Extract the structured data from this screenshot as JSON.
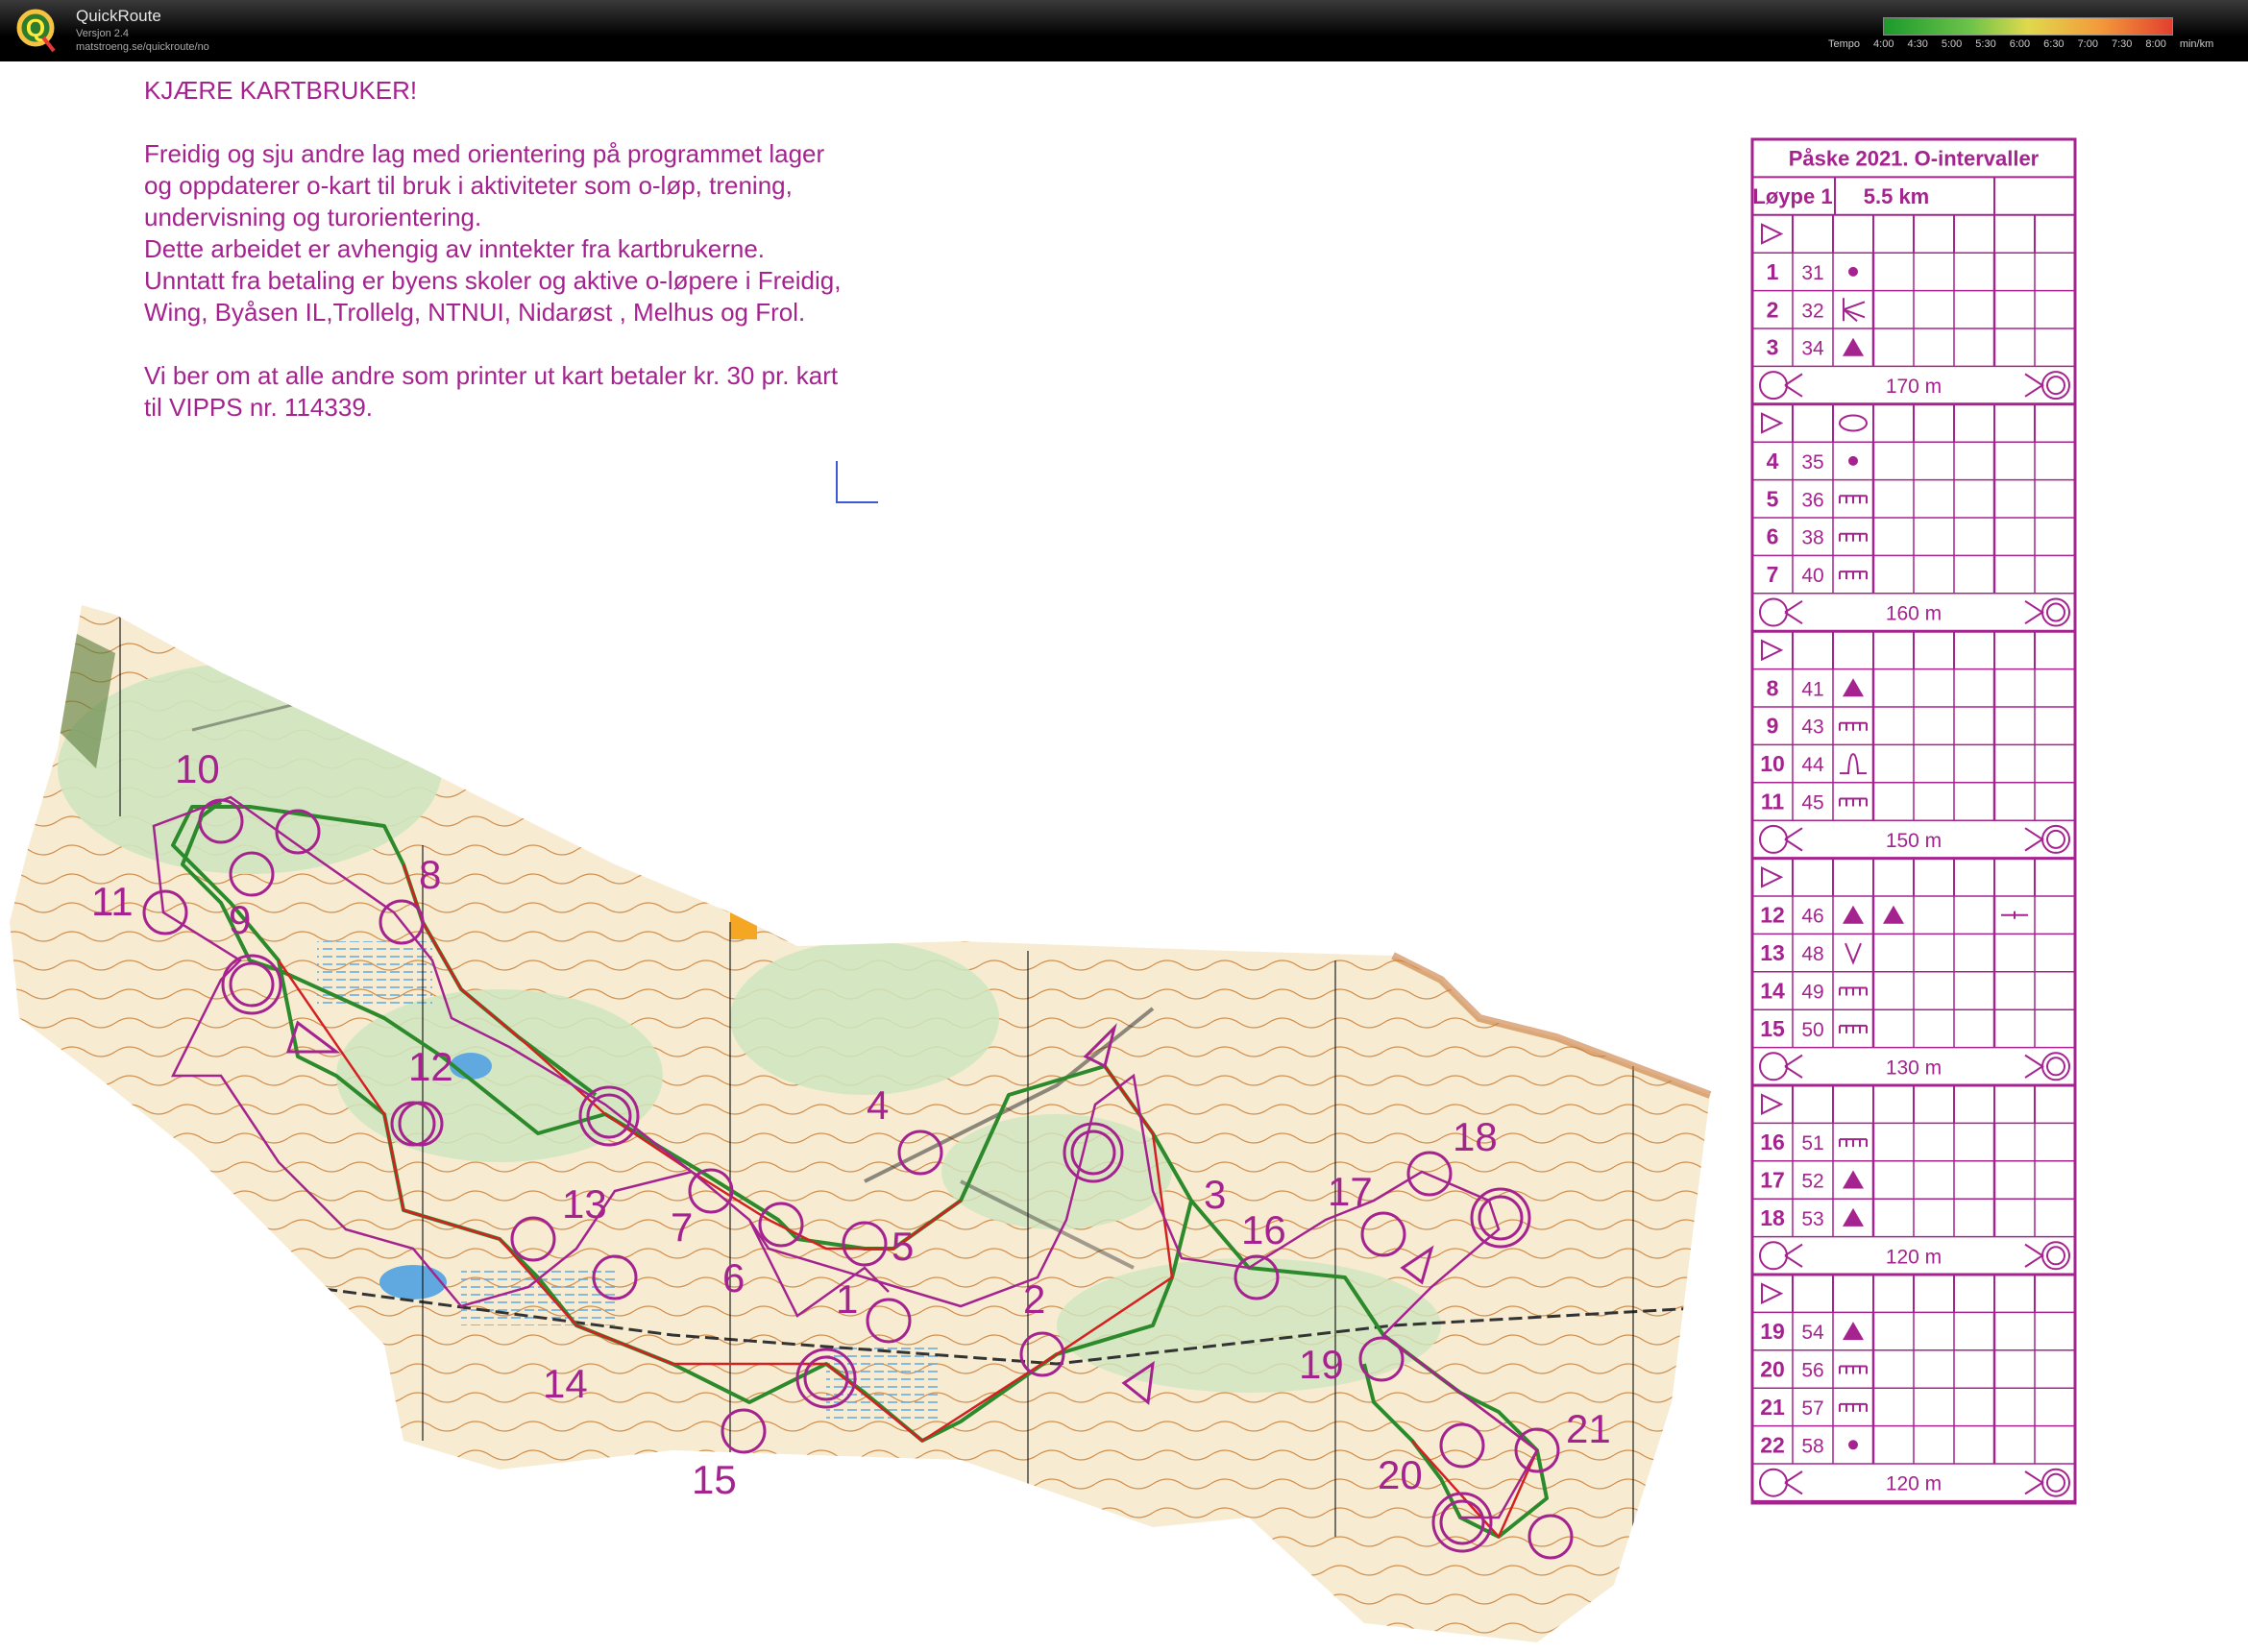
{
  "app": {
    "title": "QuickRoute",
    "version": "Versjon 2.4",
    "url": "matstroeng.se/quickroute/no"
  },
  "tempo": {
    "label": "Tempo",
    "ticks": [
      "4:00",
      "4:30",
      "5:00",
      "5:30",
      "6:00",
      "6:30",
      "7:00",
      "7:30",
      "8:00"
    ],
    "unit": "min/km"
  },
  "intro": {
    "heading": "KJÆRE KARTBRUKER!",
    "lines": [
      "Freidig og sju andre lag med orientering på programmet lager",
      "og oppdaterer o-kart til bruk i aktiviteter som o-løp, trening,",
      "undervisning og turorientering.",
      "Dette arbeidet er avhengig av inntekter fra kartbrukerne.",
      "Unntatt fra betaling er byens skoler og aktive o-løpere i Freidig,",
      "Wing, Byåsen IL,Trollelg, NTNUI, Nidarøst , Melhus og Frol."
    ],
    "lines2": [
      "Vi ber om at alle andre som printer ut kart betaler kr. 30 pr. kart",
      "til VIPPS nr.  114339."
    ]
  },
  "controls": [
    "1",
    "2",
    "3",
    "4",
    "5",
    "6",
    "7",
    "8",
    "9",
    "10",
    "11",
    "12",
    "13",
    "14",
    "15",
    "16",
    "17",
    "18",
    "19",
    "20",
    "21"
  ],
  "description_table": {
    "title": "Påske 2021. O-intervaller",
    "course": "Løype 1",
    "length": "5.5 km",
    "sections": [
      {
        "rows": [
          {
            "n": "1",
            "code": "31",
            "sym": "dot"
          },
          {
            "n": "2",
            "code": "32",
            "sym": "rootstock"
          },
          {
            "n": "3",
            "code": "34",
            "sym": "triangle"
          }
        ],
        "marked": "170 m"
      },
      {
        "start_sym": "ellipse",
        "rows": [
          {
            "n": "4",
            "code": "35",
            "sym": "dot"
          },
          {
            "n": "5",
            "code": "36",
            "sym": "comb"
          },
          {
            "n": "6",
            "code": "38",
            "sym": "comb"
          },
          {
            "n": "7",
            "code": "40",
            "sym": "comb"
          }
        ],
        "marked": "160 m"
      },
      {
        "rows": [
          {
            "n": "8",
            "code": "41",
            "sym": "triangle"
          },
          {
            "n": "9",
            "code": "43",
            "sym": "comb"
          },
          {
            "n": "10",
            "code": "44",
            "sym": "knoll"
          },
          {
            "n": "11",
            "code": "45",
            "sym": "comb"
          }
        ],
        "marked": "150 m"
      },
      {
        "rows": [
          {
            "n": "12",
            "code": "46",
            "sym": "triangle",
            "extra": "triangle",
            "extra2": "side"
          },
          {
            "n": "13",
            "code": "48",
            "sym": "v"
          },
          {
            "n": "14",
            "code": "49",
            "sym": "comb"
          },
          {
            "n": "15",
            "code": "50",
            "sym": "comb"
          }
        ],
        "marked": "130 m"
      },
      {
        "rows": [
          {
            "n": "16",
            "code": "51",
            "sym": "comb"
          },
          {
            "n": "17",
            "code": "52",
            "sym": "triangle"
          },
          {
            "n": "18",
            "code": "53",
            "sym": "triangle"
          }
        ],
        "marked": "120 m"
      },
      {
        "rows": [
          {
            "n": "19",
            "code": "54",
            "sym": "triangle"
          },
          {
            "n": "20",
            "code": "56",
            "sym": "comb"
          },
          {
            "n": "21",
            "code": "57",
            "sym": "comb"
          },
          {
            "n": "22",
            "code": "58",
            "sym": "dot"
          }
        ],
        "marked": "120 m"
      }
    ]
  },
  "colors": {
    "course": "#a5238f",
    "route_red": "#d42020",
    "route_green": "#2c8a2c",
    "forest": "#cfe6bf",
    "open": "#f3e3b4",
    "contour": "#c8762a",
    "water": "#5fa9e0"
  }
}
